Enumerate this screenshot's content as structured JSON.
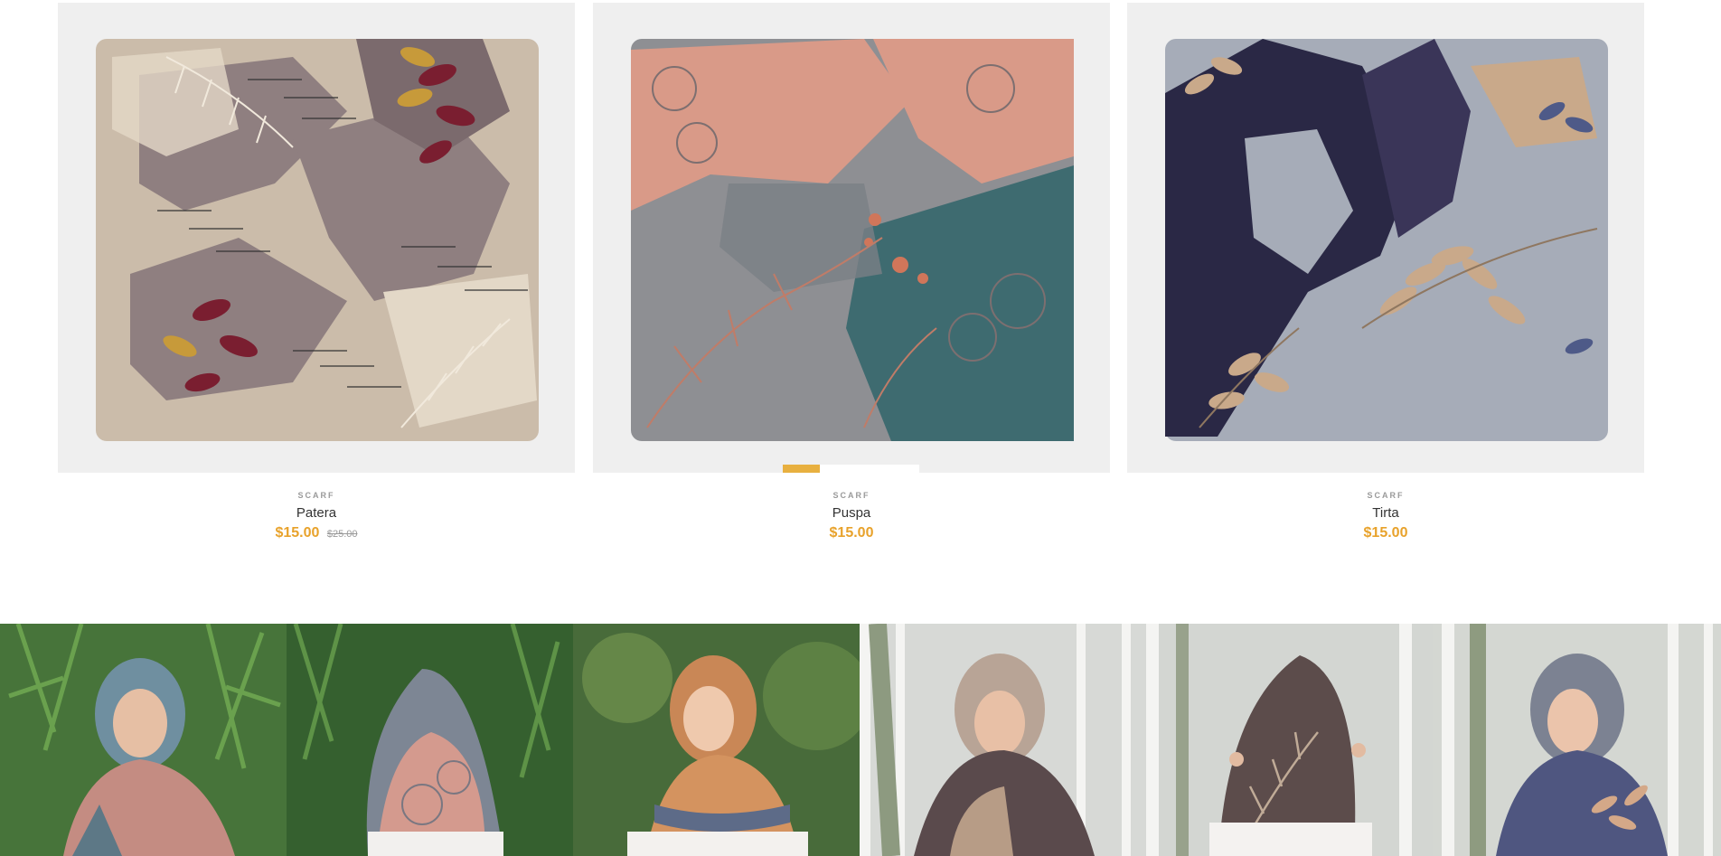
{
  "products": [
    {
      "category": "SCARF",
      "name": "Patera",
      "price": "$15.00",
      "old_price": "$25.00"
    },
    {
      "category": "SCARF",
      "name": "Puspa",
      "price": "$15.00",
      "old_price": ""
    },
    {
      "category": "SCARF",
      "name": "Tirta",
      "price": "$15.00",
      "old_price": ""
    }
  ],
  "colors": {
    "accent": "#e8a22b",
    "muted": "#9a9a9a",
    "text": "#333333",
    "card_bg": "#efefef"
  },
  "gallery": {
    "icons": [
      "hijab-photo-1",
      "hijab-photo-2",
      "hijab-photo-3",
      "hijab-photo-4",
      "hijab-photo-5",
      "hijab-photo-6"
    ]
  }
}
